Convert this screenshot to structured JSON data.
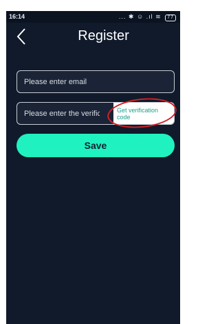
{
  "status_bar": {
    "time": "16:14",
    "icons": "... ✱ ☺ .ıl ≋",
    "battery": "77"
  },
  "header": {
    "back_icon": "chevron-left-icon",
    "title": "Register"
  },
  "form": {
    "email_placeholder": "Please enter email",
    "code_placeholder": "Please enter the verification",
    "get_code_label": "Get verification code",
    "save_label": "Save"
  },
  "colors": {
    "background": "#101a2b",
    "accent": "#1ff2c0",
    "link": "#1aa08a",
    "highlight_circle": "#d12128"
  }
}
